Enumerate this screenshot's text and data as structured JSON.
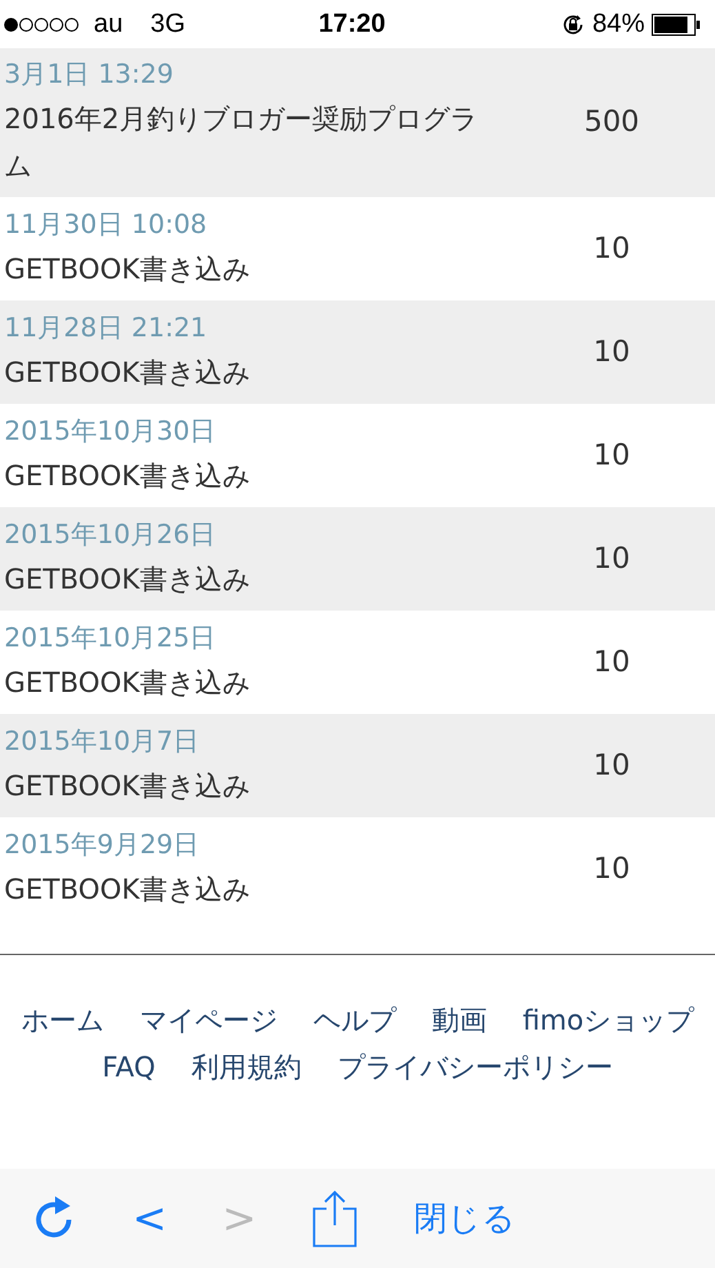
{
  "status_bar": {
    "carrier": "au",
    "network": "3G",
    "time": "17:20",
    "battery": "84%"
  },
  "history": [
    {
      "date": "3月1日 13:29",
      "title": "2016年2月釣りブロガー奨励プログラム",
      "points": "500"
    },
    {
      "date": "11月30日 10:08",
      "title": "GETBOOK書き込み",
      "points": "10"
    },
    {
      "date": "11月28日 21:21",
      "title": "GETBOOK書き込み",
      "points": "10"
    },
    {
      "date": "2015年10月30日",
      "title": "GETBOOK書き込み",
      "points": "10"
    },
    {
      "date": "2015年10月26日",
      "title": "GETBOOK書き込み",
      "points": "10"
    },
    {
      "date": "2015年10月25日",
      "title": "GETBOOK書き込み",
      "points": "10"
    },
    {
      "date": "2015年10月7日",
      "title": "GETBOOK書き込み",
      "points": "10"
    },
    {
      "date": "2015年9月29日",
      "title": "GETBOOK書き込み",
      "points": "10"
    }
  ],
  "footer_links": [
    [
      "ホーム",
      "マイページ",
      "ヘルプ",
      "動画",
      "fimoショップ"
    ],
    [
      "FAQ",
      "利用規約",
      "プライバシーポリシー"
    ]
  ],
  "toolbar": {
    "back": {
      "label": "<",
      "disabled": false
    },
    "forward": {
      "label": ">",
      "disabled": true
    },
    "close": "閉じる"
  }
}
